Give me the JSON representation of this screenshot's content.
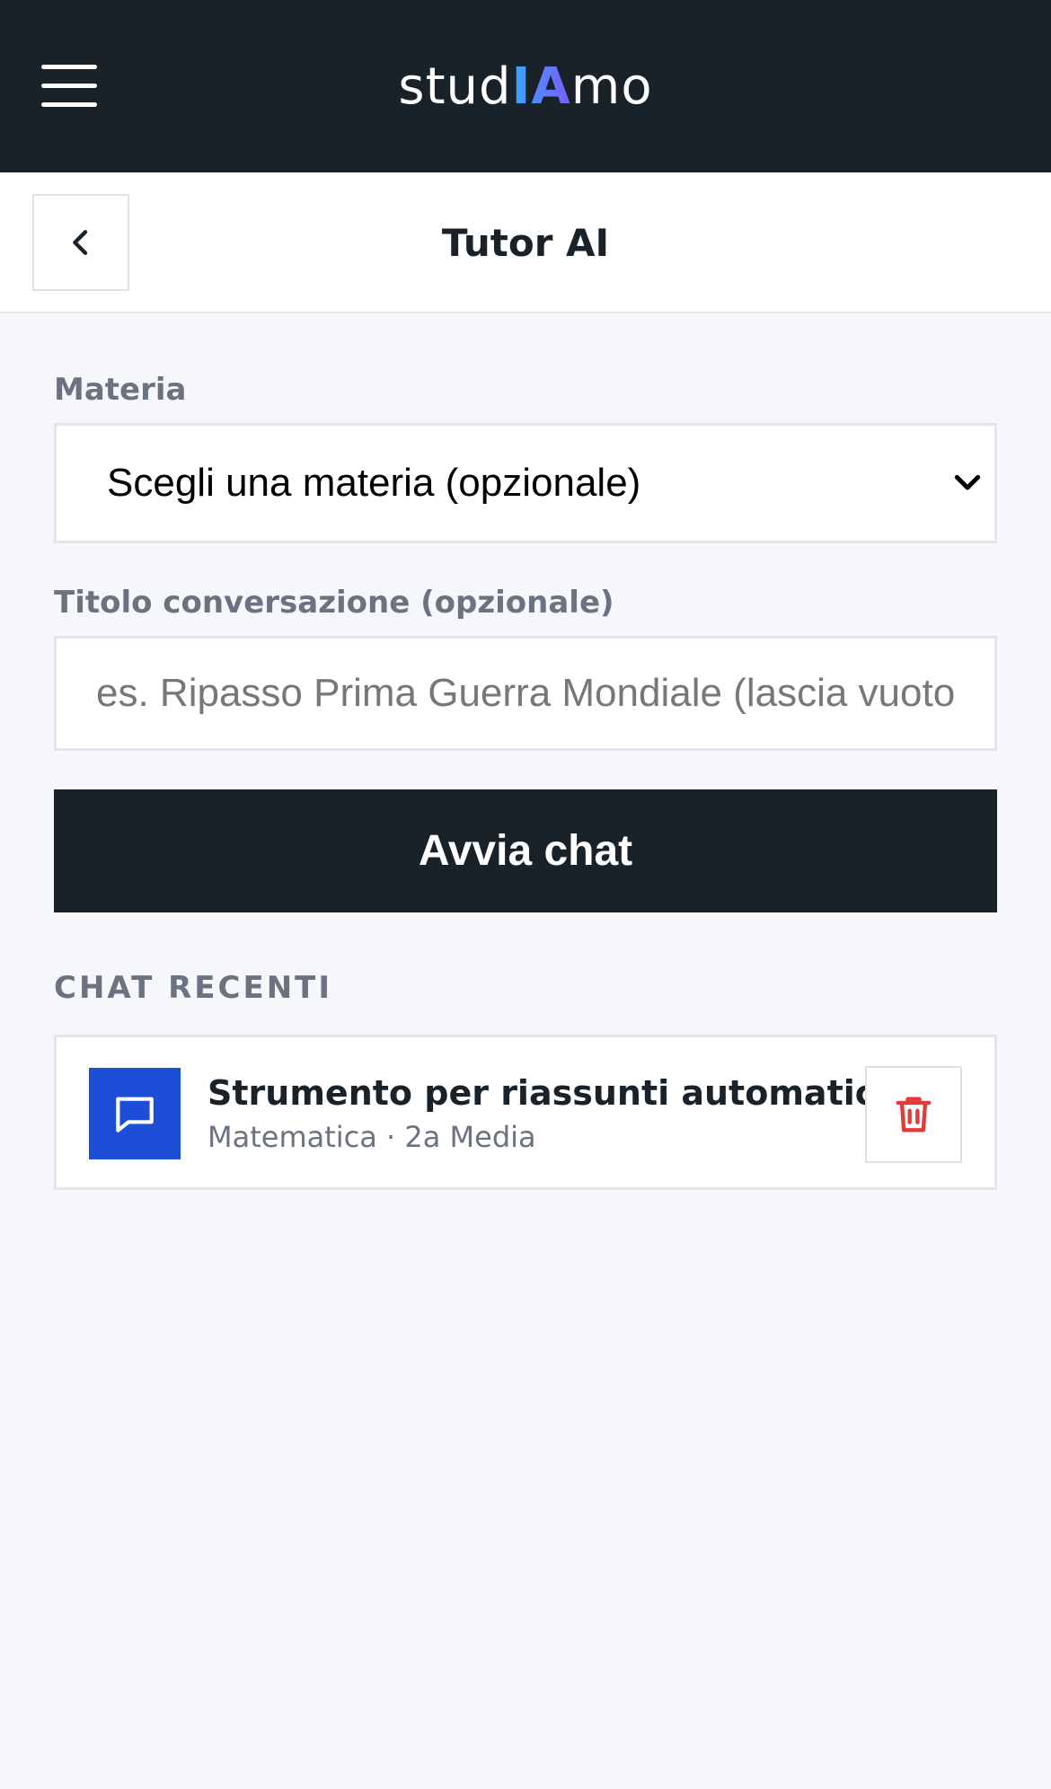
{
  "app": {
    "logo_prefix": "stud",
    "logo_accent": "IA",
    "logo_suffix": "mo"
  },
  "header": {
    "menu_icon": "hamburger-menu-icon",
    "back_icon": "chevron-left-icon",
    "title": "Tutor AI"
  },
  "form": {
    "subject_label": "Materia",
    "subject_selected": "Scegli una materia (opzionale)",
    "subject_chevron_icon": "chevron-down-icon",
    "title_label": "Titolo conversazione (opzionale)",
    "title_placeholder": "es. Ripasso Prima Guerra Mondiale (lascia vuoto per generarlo automaticamente)",
    "title_value": "",
    "start_button": "Avvia chat"
  },
  "recent": {
    "section_title": "CHAT RECENTI",
    "items": [
      {
        "title": "Strumento per riassunti automatici",
        "meta": "Matematica · 2a Media",
        "icon": "chat-bubble-icon",
        "delete_icon": "trash-icon"
      }
    ]
  },
  "colors": {
    "topbar": "#1a2229",
    "primary_button": "#1a2229",
    "chat_icon_bg": "#1d4ed8",
    "delete_icon": "#e53935",
    "logo_gradient_start": "#36a7ff",
    "logo_gradient_end": "#7a5cff",
    "page_background": "#f6f7fb"
  }
}
